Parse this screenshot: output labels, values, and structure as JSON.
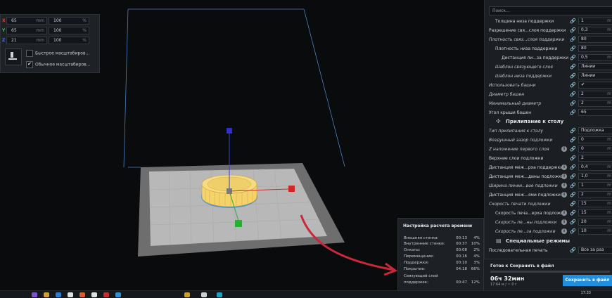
{
  "scale_panel": {
    "rows": [
      {
        "axis": "X",
        "axis_color": "#e04141",
        "value": "65",
        "unit": "mm",
        "percent": "100",
        "percent_unit": "%"
      },
      {
        "axis": "Y",
        "axis_color": "#3fbf4f",
        "value": "65",
        "unit": "mm",
        "percent": "100",
        "percent_unit": "%"
      },
      {
        "axis": "Z",
        "axis_color": "#4a6fe0",
        "value": "21",
        "unit": "mm",
        "percent": "100",
        "percent_unit": "%"
      }
    ],
    "opt_fast": "Быстрое масштабиров...",
    "opt_normal": "Обычное масштабиров...",
    "check_mark": "✔"
  },
  "settings": {
    "search_placeholder": "Поиск...",
    "rows": [
      {
        "label": "Толщина низа поддержки",
        "value": "1",
        "unit": "m",
        "indent": 1
      },
      {
        "label": "Разрешение свя...слоя поддержки",
        "value": "0,3",
        "unit": "m",
        "indent": 0
      },
      {
        "label": "Плотность связ...слоя поддержки",
        "value": "80",
        "unit": "",
        "indent": 0,
        "italic": true
      },
      {
        "label": "Плотность низа поддержки",
        "value": "80",
        "unit": "",
        "indent": 1
      },
      {
        "label": "Дистанция ли...за поддержки",
        "value": "0,5",
        "unit": "m",
        "indent": 2
      },
      {
        "label": "Шаблон связующего слоя",
        "value": "Линии",
        "unit": "",
        "indent": 1,
        "italic": true
      },
      {
        "label": "Шаблон низа поддержки",
        "value": "Линии",
        "unit": "",
        "indent": 1,
        "italic": true
      },
      {
        "label": "Использовать башни",
        "value": "✔",
        "unit": "",
        "indent": 0,
        "italic": true
      },
      {
        "label": "Диаметр башен",
        "value": "2",
        "unit": "m",
        "indent": 0,
        "italic": true
      },
      {
        "label": "Минимальный диаметр",
        "value": "2",
        "unit": "m",
        "indent": 0,
        "italic": true
      },
      {
        "label": "Угол крыши башен",
        "value": "65",
        "unit": "",
        "indent": 0
      }
    ],
    "section_adhesion": "Прилипание к столу",
    "section_adhesion_icon": "✣",
    "rows2": [
      {
        "label": "Тип прилипания к столу",
        "value": "Подложка",
        "unit": "",
        "indent": 0,
        "italic": true
      },
      {
        "label": "Воздушный зазор подложки",
        "value": "0",
        "unit": "m",
        "indent": 0,
        "italic": true
      },
      {
        "label": "Z наложение первого слоя",
        "value": "0",
        "unit": "m",
        "indent": 0,
        "italic": true,
        "info": "i"
      },
      {
        "label": "Верхние слои подложки",
        "value": "2",
        "unit": "",
        "indent": 0
      },
      {
        "label": "Дистанция меж...рха поддержки",
        "value": "0,4",
        "unit": "m",
        "indent": 0,
        "info": "i"
      },
      {
        "label": "Дистанция меж...дины подложки",
        "value": "1,0",
        "unit": "m",
        "indent": 0,
        "info": "i"
      },
      {
        "label": "Ширина линии...вое подложки",
        "value": "1",
        "unit": "m",
        "indent": 0,
        "italic": true,
        "info": "i"
      },
      {
        "label": "Дистанция меж...ями подложки",
        "value": "2",
        "unit": "m",
        "indent": 0,
        "info": "i"
      },
      {
        "label": "Скорость печати подложки",
        "value": "15",
        "unit": "m",
        "indent": 0,
        "italic": true
      },
      {
        "label": "Скорость печа...ерха подложки",
        "value": "15",
        "unit": "m",
        "indent": 1,
        "info": "i"
      },
      {
        "label": "Скорость пе...ны подложки",
        "value": "20",
        "unit": "m",
        "indent": 1,
        "italic": true,
        "info": "i"
      },
      {
        "label": "Скорость пе...за подложки",
        "value": "10",
        "unit": "m",
        "indent": 1,
        "italic": true,
        "info": "i"
      }
    ],
    "section_special": "Специальные режимы",
    "section_special_icon": "▤",
    "last_row": {
      "label": "Последовательная печать",
      "value": "Все за раз",
      "unit": ""
    },
    "link_icon": "🔗"
  },
  "save_panel": {
    "ready": "Готов к Сохранить в файл",
    "time": "06ч 32мин",
    "weight": "17.64 м / ~ 0 г",
    "save_label": "Сохранить в файл"
  },
  "time_popup": {
    "title": "Настройка расчета времени",
    "rows": [
      {
        "name": "Внешняя стенка:",
        "time": "00:13",
        "pct": "4%"
      },
      {
        "name": "Внутренние стенки:",
        "time": "00:37",
        "pct": "10%"
      },
      {
        "name": "Откаты:",
        "time": "00:08",
        "pct": "2%"
      },
      {
        "name": "Перемещение:",
        "time": "00:16",
        "pct": "4%"
      },
      {
        "name": "Поддержки:",
        "time": "00:10",
        "pct": "3%"
      },
      {
        "name": "Покрытие:",
        "time": "04:18",
        "pct": "66%"
      },
      {
        "name": "Связующий слой",
        "time": "",
        "pct": ""
      },
      {
        "name": "поддержек:",
        "time": "00:47",
        "pct": "12%"
      }
    ]
  },
  "taskbar": {
    "clock": "17:33"
  },
  "colors": {
    "accent": "#1f8fde",
    "model": "#f5d36a",
    "annotation": "#c8283a",
    "bed": "#b5b5b5"
  }
}
